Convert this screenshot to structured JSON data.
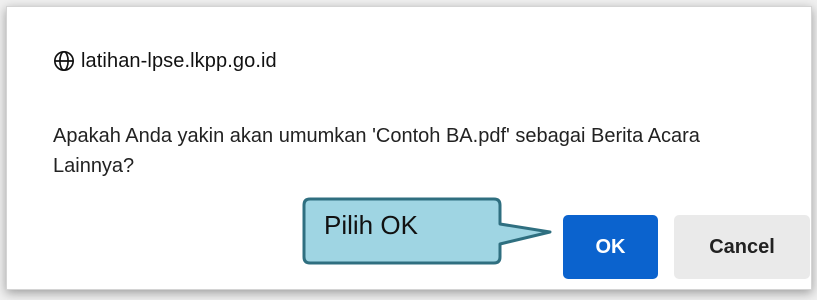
{
  "dialog": {
    "origin": "latihan-lpse.lkpp.go.id",
    "origin_icon": "globe-icon",
    "message": "Apakah Anda yakin akan umumkan 'Contoh BA.pdf' sebagai Berita Acara Lainnya?",
    "ok_label": "OK",
    "cancel_label": "Cancel"
  },
  "callout": {
    "text": "Pilih OK",
    "fill_color": "#9fd5e3",
    "border_color": "#2f6f80"
  },
  "colors": {
    "ok_button": "#0b63ce",
    "cancel_button": "#eaeaea"
  }
}
